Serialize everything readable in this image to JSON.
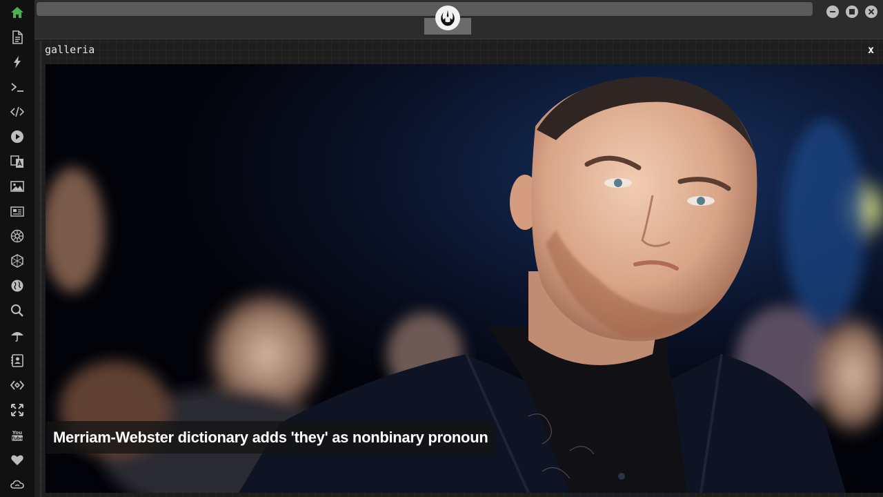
{
  "app": {
    "panel_title": "galleria",
    "panel_close": "x"
  },
  "sidebar": {
    "items": [
      {
        "name": "home-icon"
      },
      {
        "name": "document-icon"
      },
      {
        "name": "lightning-icon"
      },
      {
        "name": "terminal-icon"
      },
      {
        "name": "code-icon"
      },
      {
        "name": "play-icon"
      },
      {
        "name": "translate-icon"
      },
      {
        "name": "image-icon"
      },
      {
        "name": "newspaper-icon"
      },
      {
        "name": "galactic-empire-icon"
      },
      {
        "name": "hexagon-icon"
      },
      {
        "name": "globe-icon"
      },
      {
        "name": "search-icon"
      },
      {
        "name": "umbrella-icon"
      },
      {
        "name": "contact-card-icon"
      },
      {
        "name": "link-code-icon"
      },
      {
        "name": "expand-icon"
      },
      {
        "name": "youtube-icon"
      },
      {
        "name": "heart-icon"
      },
      {
        "name": "cloud-icon"
      }
    ],
    "active_color": "#4caf50",
    "icon_color": "#bdbdbd"
  },
  "gallery": {
    "caption": "Merriam-Webster dictionary adds 'they' as nonbinary pronoun"
  }
}
